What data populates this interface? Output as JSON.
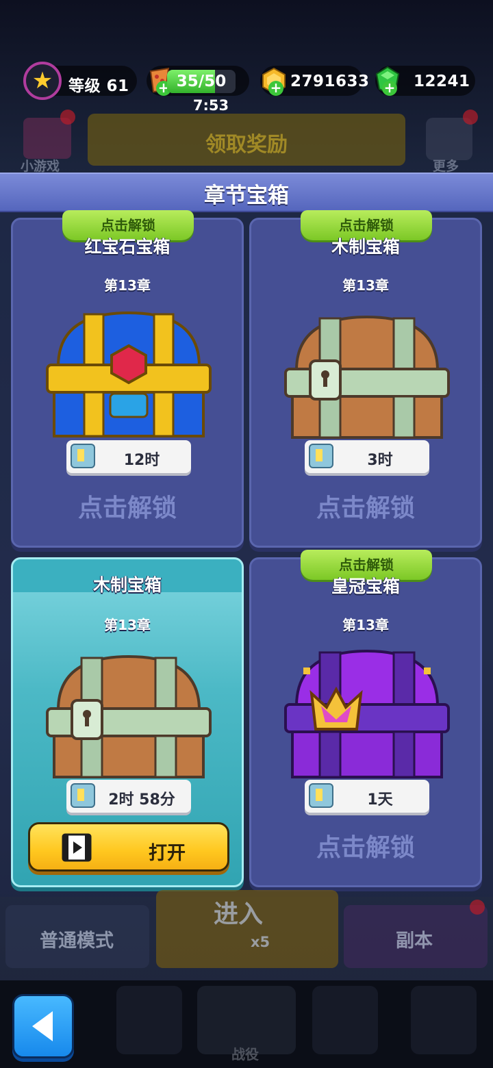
{
  "top_bar": {
    "level_label": "等级 61",
    "energy_value": "35/50",
    "energy_fraction": 0.7,
    "energy_timer": "7:53",
    "coins": "2791633",
    "gems": "12241"
  },
  "background": {
    "minigame_label": "小游戏",
    "claim_reward_label": "领取奖励",
    "more_label": "更多",
    "normal_mode_label": "普通模式",
    "enter_label": "进入",
    "enter_cost": "x5",
    "dungeon_label": "副本",
    "battle_tab_label": "战役"
  },
  "panel": {
    "title": "章节宝箱"
  },
  "cards": [
    {
      "tag": "点击解锁",
      "name": "红宝石宝箱",
      "chapter": "第13章",
      "time": "12时",
      "action": "点击解锁"
    },
    {
      "tag": "点击解锁",
      "name": "木制宝箱",
      "chapter": "第13章",
      "time": "3时",
      "action": "点击解锁"
    },
    {
      "name": "木制宝箱",
      "chapter": "第13章",
      "time": "2时 58分",
      "open_label": "打开"
    },
    {
      "tag": "点击解锁",
      "name": "皇冠宝箱",
      "chapter": "第13章",
      "time": "1天",
      "action": "点击解锁"
    }
  ],
  "colors": {
    "header_blue": "#5566bd",
    "card_blue": "#454f94",
    "card_active": "#4cb9c6",
    "tag_green": "#8fd43a",
    "button_yellow": "#ffc71f",
    "back_blue": "#1789ec"
  },
  "icons": [
    "star-icon",
    "energy-icon",
    "coin-icon",
    "gem-icon",
    "clock-icon",
    "video-icon",
    "back-arrow-icon"
  ]
}
